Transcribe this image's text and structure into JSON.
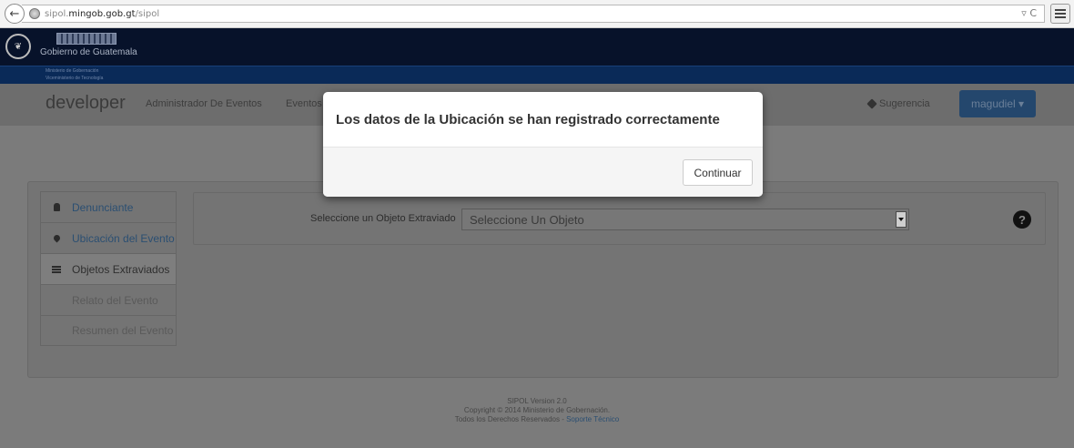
{
  "browser": {
    "url_prefix": "sipol.",
    "url_domain": "mingob.gob.gt",
    "url_path": "/sipol",
    "reload_glyph": "▿ C"
  },
  "gov": {
    "name": "Gobierno de Guatemala",
    "sub1": "Ministerio de Gobernación",
    "sub2": "Viceministerio de Tecnología"
  },
  "navbar": {
    "brand": "developer",
    "links": [
      "Administrador De Eventos",
      "Eventos"
    ],
    "suggestion": "Sugerencia",
    "user": "magudiel ▾"
  },
  "steps": [
    {
      "label": "Denunciante",
      "icon": "user-icon"
    },
    {
      "label": "Ubicación del Evento",
      "icon": "map-marker-icon"
    },
    {
      "label": "Objetos Extraviados",
      "icon": "list-icon"
    },
    {
      "label": "Relato del Evento"
    },
    {
      "label": "Resumen del Evento"
    }
  ],
  "form": {
    "label": "Seleccione un Objeto Extraviado",
    "select_value": "Seleccione Un Objeto",
    "help": "?"
  },
  "footer": {
    "version": "SIPOL Version 2.0",
    "copyright": "Copyright © 2014 Ministerio de Gobernación.",
    "rights": "Todos los Derechos Reservados -",
    "support": "Soporte Técnico"
  },
  "modal": {
    "title": "Los datos de la Ubicación se han registrado correctamente",
    "button": "Continuar"
  }
}
